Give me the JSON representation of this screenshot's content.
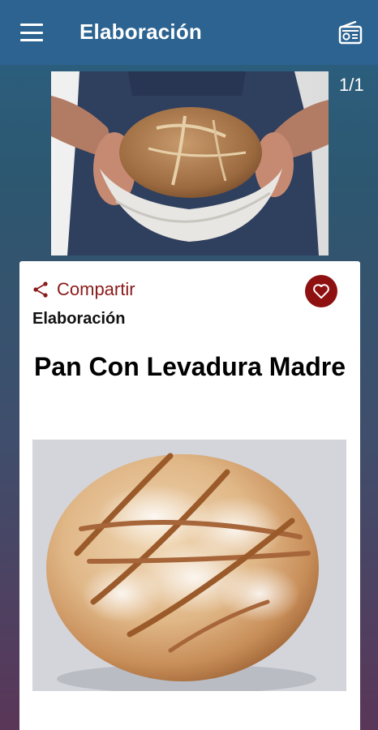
{
  "appbar": {
    "title": "Elaboración",
    "menu_icon": "hamburger-menu-icon",
    "radio_icon": "radio-icon"
  },
  "carousel": {
    "counter": "1/1",
    "image": "hands-holding-bread-loaf"
  },
  "card": {
    "share_label": "Compartir",
    "share_icon": "share-icon",
    "favorite_icon": "heart-icon",
    "category": "Elaboración",
    "title": "Pan Con Levadura Madre",
    "image": "sourdough-bread-loaf"
  },
  "colors": {
    "appbar": "#2c6390",
    "accent": "#8e1010",
    "share_text": "#8b1a1a"
  }
}
